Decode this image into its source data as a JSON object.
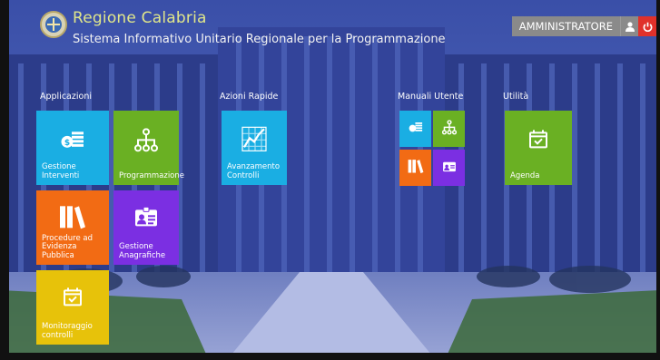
{
  "header": {
    "title": "Regione Calabria",
    "subtitle": "Sistema Informativo Unitario Regionale per la Programmazione",
    "user_label": "AMMINISTRATORE"
  },
  "sections": {
    "applicazioni": "Applicazioni",
    "azioni_rapide": "Azioni Rapide",
    "manuali_utente": "Manuali Utente",
    "utilita": "Utilità"
  },
  "tiles": {
    "gestione_interventi": "Gestione Interventi",
    "programmazione": "Programmazione",
    "procedure": "Procedure ad Evidenza Pubblica",
    "gestione_anagrafiche": "Gestione Anagrafiche",
    "monitoraggio": "Monitoraggio controlli",
    "avanzamento": "Avanzamento Controlli",
    "agenda": "Agenda"
  },
  "icons": {
    "gestione_interventi": "money-stack-icon",
    "programmazione": "hierarchy-icon",
    "procedure": "books-icon",
    "gestione_anagrafiche": "id-card-icon",
    "monitoraggio": "calendar-check-icon",
    "avanzamento": "chart-line-icon",
    "agenda": "calendar-check-icon",
    "user": "user-icon",
    "power": "power-icon"
  },
  "colors": {
    "blue": "#1aaee3",
    "green": "#6ab023",
    "orange": "#f26b14",
    "purple": "#7b2fe2",
    "yellow": "#e7c20a",
    "title": "#e0e68a",
    "power": "#e0312b"
  }
}
